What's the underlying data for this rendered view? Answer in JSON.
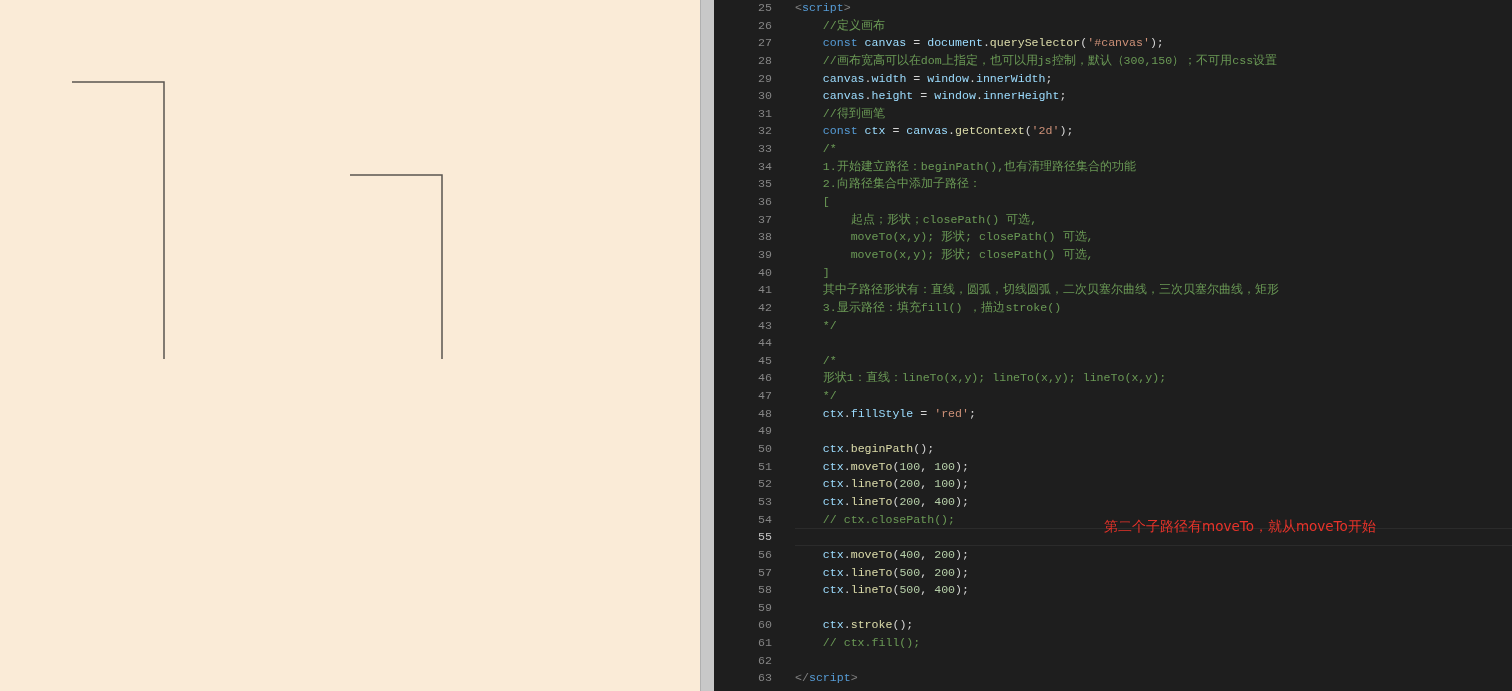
{
  "editor": {
    "lines": [
      {
        "number": "25",
        "current": false,
        "tokens": [
          {
            "kind": "tagbracket",
            "text": "<"
          },
          {
            "kind": "tag",
            "text": "script"
          },
          {
            "kind": "tagbracket",
            "text": ">"
          }
        ]
      },
      {
        "number": "26",
        "current": false,
        "tokens": [
          {
            "kind": "comment",
            "text": "    //定义画布"
          }
        ]
      },
      {
        "number": "27",
        "current": false,
        "tokens": [
          {
            "kind": "keyword",
            "text": "    const "
          },
          {
            "kind": "variable",
            "text": "canvas"
          },
          {
            "kind": "plain",
            "text": " = "
          },
          {
            "kind": "variable",
            "text": "document"
          },
          {
            "kind": "plain",
            "text": "."
          },
          {
            "kind": "function",
            "text": "querySelector"
          },
          {
            "kind": "plain",
            "text": "("
          },
          {
            "kind": "string",
            "text": "'#canvas'"
          },
          {
            "kind": "plain",
            "text": ");"
          }
        ]
      },
      {
        "number": "28",
        "current": false,
        "tokens": [
          {
            "kind": "comment",
            "text": "    //画布宽高可以在dom上指定，也可以用js控制，默认（300,150）；不可用css设置"
          }
        ]
      },
      {
        "number": "29",
        "current": false,
        "tokens": [
          {
            "kind": "variable",
            "text": "    canvas"
          },
          {
            "kind": "plain",
            "text": "."
          },
          {
            "kind": "variable",
            "text": "width"
          },
          {
            "kind": "plain",
            "text": " = "
          },
          {
            "kind": "variable",
            "text": "window"
          },
          {
            "kind": "plain",
            "text": "."
          },
          {
            "kind": "variable",
            "text": "innerWidth"
          },
          {
            "kind": "plain",
            "text": ";"
          }
        ]
      },
      {
        "number": "30",
        "current": false,
        "tokens": [
          {
            "kind": "variable",
            "text": "    canvas"
          },
          {
            "kind": "plain",
            "text": "."
          },
          {
            "kind": "variable",
            "text": "height"
          },
          {
            "kind": "plain",
            "text": " = "
          },
          {
            "kind": "variable",
            "text": "window"
          },
          {
            "kind": "plain",
            "text": "."
          },
          {
            "kind": "variable",
            "text": "innerHeight"
          },
          {
            "kind": "plain",
            "text": ";"
          }
        ]
      },
      {
        "number": "31",
        "current": false,
        "tokens": [
          {
            "kind": "comment",
            "text": "    //得到画笔"
          }
        ]
      },
      {
        "number": "32",
        "current": false,
        "tokens": [
          {
            "kind": "keyword",
            "text": "    const "
          },
          {
            "kind": "variable",
            "text": "ctx"
          },
          {
            "kind": "plain",
            "text": " = "
          },
          {
            "kind": "variable",
            "text": "canvas"
          },
          {
            "kind": "plain",
            "text": "."
          },
          {
            "kind": "function",
            "text": "getContext"
          },
          {
            "kind": "plain",
            "text": "("
          },
          {
            "kind": "string",
            "text": "'2d'"
          },
          {
            "kind": "plain",
            "text": ");"
          }
        ]
      },
      {
        "number": "33",
        "current": false,
        "tokens": [
          {
            "kind": "comment",
            "text": "    /*"
          }
        ]
      },
      {
        "number": "34",
        "current": false,
        "tokens": [
          {
            "kind": "comment",
            "text": "    1.开始建立路径：beginPath(),也有清理路径集合的功能"
          }
        ]
      },
      {
        "number": "35",
        "current": false,
        "tokens": [
          {
            "kind": "comment",
            "text": "    2.向路径集合中添加子路径："
          }
        ]
      },
      {
        "number": "36",
        "current": false,
        "tokens": [
          {
            "kind": "comment",
            "text": "    ["
          }
        ]
      },
      {
        "number": "37",
        "current": false,
        "tokens": [
          {
            "kind": "comment",
            "text": "        起点；形状；closePath() 可选,"
          }
        ]
      },
      {
        "number": "38",
        "current": false,
        "tokens": [
          {
            "kind": "comment",
            "text": "        moveTo(x,y); 形状; closePath() 可选,"
          }
        ]
      },
      {
        "number": "39",
        "current": false,
        "tokens": [
          {
            "kind": "comment",
            "text": "        moveTo(x,y); 形状; closePath() 可选,"
          }
        ]
      },
      {
        "number": "40",
        "current": false,
        "tokens": [
          {
            "kind": "comment",
            "text": "    ]"
          }
        ]
      },
      {
        "number": "41",
        "current": false,
        "tokens": [
          {
            "kind": "comment",
            "text": "    其中子路径形状有：直线，圆弧，切线圆弧，二次贝塞尔曲线，三次贝塞尔曲线，矩形"
          }
        ]
      },
      {
        "number": "42",
        "current": false,
        "tokens": [
          {
            "kind": "comment",
            "text": "    3.显示路径：填充fill() ，描边stroke()"
          }
        ]
      },
      {
        "number": "43",
        "current": false,
        "tokens": [
          {
            "kind": "comment",
            "text": "    */"
          }
        ]
      },
      {
        "number": "44",
        "current": false
      },
      {
        "number": "45",
        "current": false,
        "tokens": [
          {
            "kind": "comment",
            "text": "    /*"
          }
        ]
      },
      {
        "number": "46",
        "current": false,
        "tokens": [
          {
            "kind": "comment",
            "text": "    形状1：直线：lineTo(x,y); lineTo(x,y); lineTo(x,y);"
          }
        ]
      },
      {
        "number": "47",
        "current": false,
        "tokens": [
          {
            "kind": "comment",
            "text": "    */"
          }
        ]
      },
      {
        "number": "48",
        "current": false,
        "tokens": [
          {
            "kind": "variable",
            "text": "    ctx"
          },
          {
            "kind": "plain",
            "text": "."
          },
          {
            "kind": "variable",
            "text": "fillStyle"
          },
          {
            "kind": "plain",
            "text": " = "
          },
          {
            "kind": "string",
            "text": "'red'"
          },
          {
            "kind": "plain",
            "text": ";"
          }
        ]
      },
      {
        "number": "49",
        "current": false
      },
      {
        "number": "50",
        "current": false,
        "tokens": [
          {
            "kind": "variable",
            "text": "    ctx"
          },
          {
            "kind": "plain",
            "text": "."
          },
          {
            "kind": "function",
            "text": "beginPath"
          },
          {
            "kind": "plain",
            "text": "();"
          }
        ]
      },
      {
        "number": "51",
        "current": false,
        "tokens": [
          {
            "kind": "variable",
            "text": "    ctx"
          },
          {
            "kind": "plain",
            "text": "."
          },
          {
            "kind": "function",
            "text": "moveTo"
          },
          {
            "kind": "plain",
            "text": "("
          },
          {
            "kind": "number",
            "text": "100"
          },
          {
            "kind": "plain",
            "text": ", "
          },
          {
            "kind": "number",
            "text": "100"
          },
          {
            "kind": "plain",
            "text": ");"
          }
        ]
      },
      {
        "number": "52",
        "current": false,
        "tokens": [
          {
            "kind": "variable",
            "text": "    ctx"
          },
          {
            "kind": "plain",
            "text": "."
          },
          {
            "kind": "function",
            "text": "lineTo"
          },
          {
            "kind": "plain",
            "text": "("
          },
          {
            "kind": "number",
            "text": "200"
          },
          {
            "kind": "plain",
            "text": ", "
          },
          {
            "kind": "number",
            "text": "100"
          },
          {
            "kind": "plain",
            "text": ");"
          }
        ]
      },
      {
        "number": "53",
        "current": false,
        "tokens": [
          {
            "kind": "variable",
            "text": "    ctx"
          },
          {
            "kind": "plain",
            "text": "."
          },
          {
            "kind": "function",
            "text": "lineTo"
          },
          {
            "kind": "plain",
            "text": "("
          },
          {
            "kind": "number",
            "text": "200"
          },
          {
            "kind": "plain",
            "text": ", "
          },
          {
            "kind": "number",
            "text": "400"
          },
          {
            "kind": "plain",
            "text": ");"
          }
        ]
      },
      {
        "number": "54",
        "current": false,
        "tokens": [
          {
            "kind": "comment",
            "text": "    // ctx.closePath();"
          }
        ]
      },
      {
        "number": "55",
        "current": true
      },
      {
        "number": "56",
        "current": false,
        "tokens": [
          {
            "kind": "variable",
            "text": "    ctx"
          },
          {
            "kind": "plain",
            "text": "."
          },
          {
            "kind": "function",
            "text": "moveTo"
          },
          {
            "kind": "plain",
            "text": "("
          },
          {
            "kind": "number",
            "text": "400"
          },
          {
            "kind": "plain",
            "text": ", "
          },
          {
            "kind": "number",
            "text": "200"
          },
          {
            "kind": "plain",
            "text": ");"
          }
        ]
      },
      {
        "number": "57",
        "current": false,
        "tokens": [
          {
            "kind": "variable",
            "text": "    ctx"
          },
          {
            "kind": "plain",
            "text": "."
          },
          {
            "kind": "function",
            "text": "lineTo"
          },
          {
            "kind": "plain",
            "text": "("
          },
          {
            "kind": "number",
            "text": "500"
          },
          {
            "kind": "plain",
            "text": ", "
          },
          {
            "kind": "number",
            "text": "200"
          },
          {
            "kind": "plain",
            "text": ");"
          }
        ]
      },
      {
        "number": "58",
        "current": false,
        "tokens": [
          {
            "kind": "variable",
            "text": "    ctx"
          },
          {
            "kind": "plain",
            "text": "."
          },
          {
            "kind": "function",
            "text": "lineTo"
          },
          {
            "kind": "plain",
            "text": "("
          },
          {
            "kind": "number",
            "text": "500"
          },
          {
            "kind": "plain",
            "text": ", "
          },
          {
            "kind": "number",
            "text": "400"
          },
          {
            "kind": "plain",
            "text": ");"
          }
        ]
      },
      {
        "number": "59",
        "current": false
      },
      {
        "number": "60",
        "current": false,
        "tokens": [
          {
            "kind": "variable",
            "text": "    ctx"
          },
          {
            "kind": "plain",
            "text": "."
          },
          {
            "kind": "function",
            "text": "stroke"
          },
          {
            "kind": "plain",
            "text": "();"
          }
        ]
      },
      {
        "number": "61",
        "current": false,
        "tokens": [
          {
            "kind": "comment",
            "text": "    // ctx.fill();"
          }
        ]
      },
      {
        "number": "62",
        "current": false
      },
      {
        "number": "63",
        "current": false,
        "tokens": [
          {
            "kind": "tagbracket",
            "text": "</"
          },
          {
            "kind": "tag",
            "text": "script"
          },
          {
            "kind": "tagbracket",
            "text": ">"
          }
        ]
      }
    ],
    "annotation": "第二个子路径有moveTo，就从moveTo开始"
  }
}
